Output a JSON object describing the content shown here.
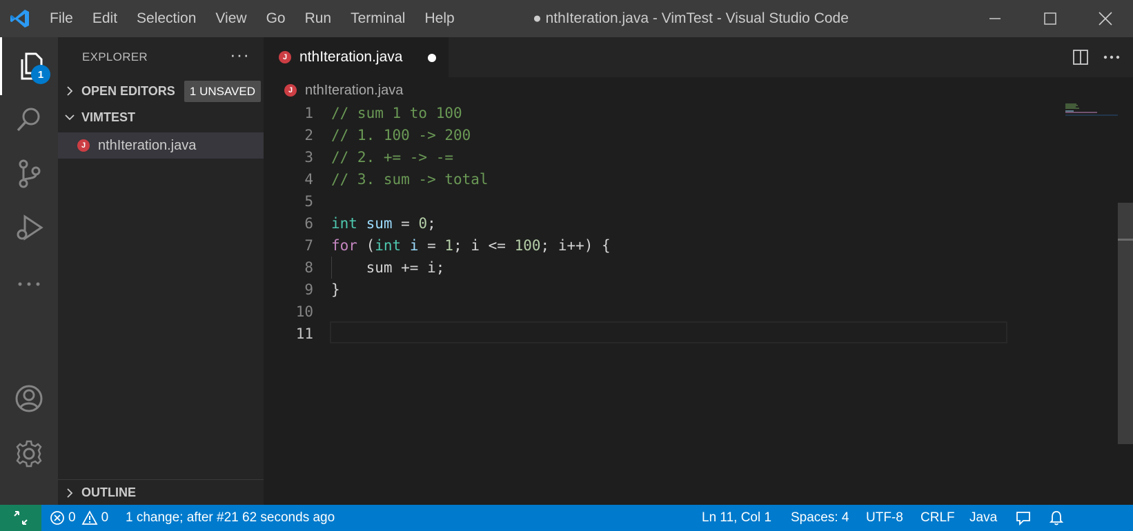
{
  "titlebar": {
    "menu": [
      "File",
      "Edit",
      "Selection",
      "View",
      "Go",
      "Run",
      "Terminal",
      "Help"
    ],
    "window_title": "● nthIteration.java - VimTest - Visual Studio Code"
  },
  "activitybar": {
    "explorer_badge": "1",
    "icons": [
      "files-icon",
      "search-icon",
      "source-control-icon",
      "run-debug-icon",
      "more-icon",
      "account-icon",
      "settings-gear-icon"
    ]
  },
  "sidebar": {
    "title": "EXPLORER",
    "more": "···",
    "open_editors": {
      "label": "OPEN EDITORS",
      "badge": "1 UNSAVED"
    },
    "folder": {
      "label": "VIMTEST"
    },
    "file": {
      "name": "nthIteration.java",
      "icon_letter": "J"
    },
    "outline": {
      "label": "OUTLINE"
    }
  },
  "editor": {
    "tab": {
      "label": "nthIteration.java",
      "icon_letter": "J"
    },
    "breadcrumb": "nthIteration.java",
    "current_line": 11,
    "lines": [
      {
        "n": "1",
        "tokens": [
          {
            "t": "// sum 1 to 100",
            "c": "comment"
          }
        ]
      },
      {
        "n": "2",
        "tokens": [
          {
            "t": "// 1. 100 -> 200",
            "c": "comment"
          }
        ]
      },
      {
        "n": "3",
        "tokens": [
          {
            "t": "// 2. += -> -=",
            "c": "comment"
          }
        ]
      },
      {
        "n": "4",
        "tokens": [
          {
            "t": "// 3. sum -> total",
            "c": "comment"
          }
        ]
      },
      {
        "n": "5",
        "tokens": []
      },
      {
        "n": "6",
        "tokens": [
          {
            "t": "int",
            "c": "type"
          },
          {
            "t": " ",
            "c": "plain"
          },
          {
            "t": "sum",
            "c": "var"
          },
          {
            "t": " = ",
            "c": "plain"
          },
          {
            "t": "0",
            "c": "num"
          },
          {
            "t": ";",
            "c": "plain"
          }
        ]
      },
      {
        "n": "7",
        "tokens": [
          {
            "t": "for",
            "c": "kw"
          },
          {
            "t": " (",
            "c": "plain"
          },
          {
            "t": "int",
            "c": "type"
          },
          {
            "t": " ",
            "c": "plain"
          },
          {
            "t": "i",
            "c": "var"
          },
          {
            "t": " = ",
            "c": "plain"
          },
          {
            "t": "1",
            "c": "num"
          },
          {
            "t": "; i <= ",
            "c": "plain"
          },
          {
            "t": "100",
            "c": "num"
          },
          {
            "t": "; i++) {",
            "c": "plain"
          }
        ]
      },
      {
        "n": "8",
        "tokens": [
          {
            "t": "    sum += i;",
            "c": "plain"
          }
        ]
      },
      {
        "n": "9",
        "tokens": [
          {
            "t": "}",
            "c": "plain"
          }
        ]
      },
      {
        "n": "10",
        "tokens": []
      },
      {
        "n": "11",
        "tokens": []
      }
    ]
  },
  "statusbar": {
    "errors": "0",
    "warnings": "0",
    "message": "1 change; after #21  62 seconds ago",
    "position": "Ln 11, Col 1",
    "spaces": "Spaces: 4",
    "encoding": "UTF-8",
    "eol": "CRLF",
    "language": "Java"
  },
  "colors": {
    "accent": "#007acc",
    "remote": "#16825d",
    "java_icon": "#cc3e44",
    "comment": "#6a9955",
    "keyword": "#c586c0",
    "type": "#4ec9b0",
    "variable": "#9cdcfe",
    "number": "#b5cea8"
  }
}
